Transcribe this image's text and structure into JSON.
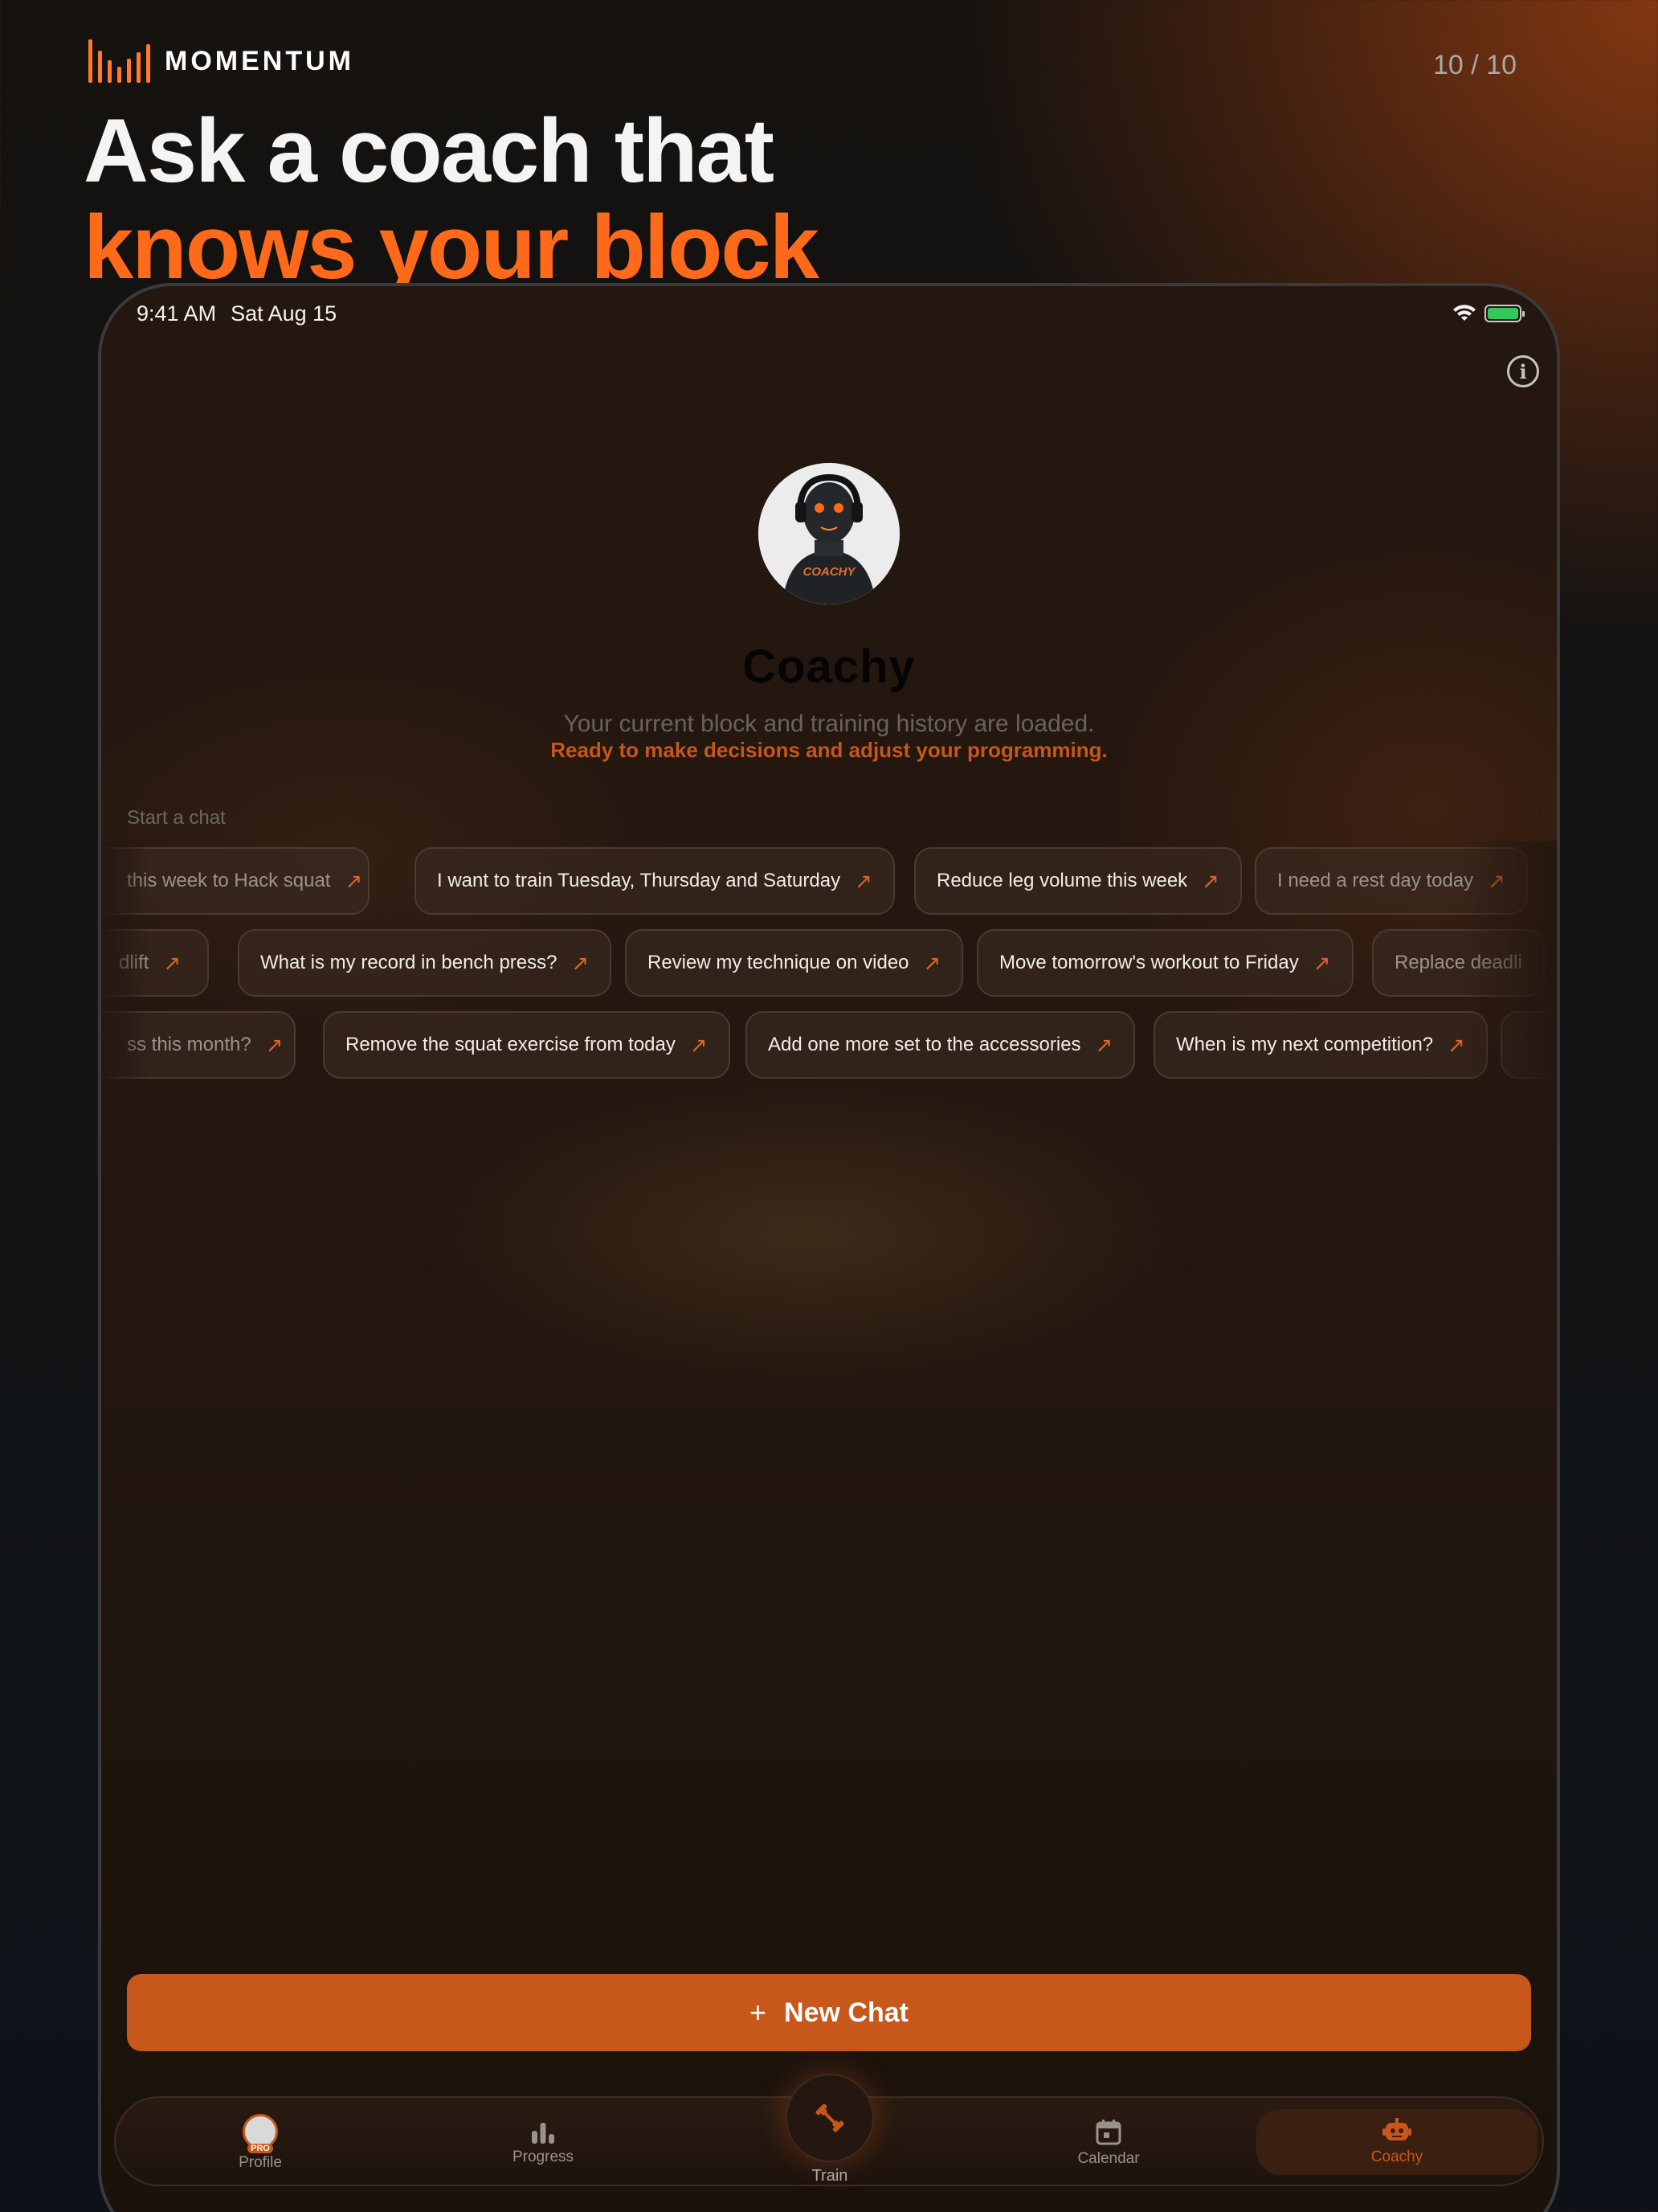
{
  "brand": {
    "name": "MOMENTUM"
  },
  "page_counter": "10 / 10",
  "headline": {
    "line1": "Ask a coach that",
    "line2": "knows your block"
  },
  "colors": {
    "accent": "#ff6a1a",
    "button": "#c8571c",
    "battery": "#34c759"
  },
  "status_bar": {
    "time": "9:41 AM",
    "date": "Sat Aug 15"
  },
  "coach": {
    "name": "Coachy",
    "avatar_text": "COACHY",
    "subtitle": "Your current block and training history are loaded.",
    "highlight": "Ready to make decisions and adjust your programming."
  },
  "start_label": "Start a chat",
  "suggestions": {
    "row1": [
      "this week to Hack squat",
      "I want to train Tuesday, Thursday and Saturday",
      "Reduce leg volume this week",
      "I need a rest day today"
    ],
    "row2": [
      "dlift",
      "What is my record in bench press?",
      "Review my technique on video",
      "Move tomorrow's workout to Friday",
      "Replace deadli"
    ],
    "row3": [
      "ss this month?",
      "Remove the squat exercise from today",
      "Add one more set to the accessories",
      "When is my next competition?"
    ]
  },
  "new_chat": {
    "icon": "plus-icon",
    "label": "New Chat"
  },
  "tabs": {
    "profile": {
      "label": "Profile",
      "badge": "PRO"
    },
    "progress": {
      "label": "Progress"
    },
    "train": {
      "label": "Train"
    },
    "calendar": {
      "label": "Calendar"
    },
    "coachy": {
      "label": "Coachy"
    }
  }
}
